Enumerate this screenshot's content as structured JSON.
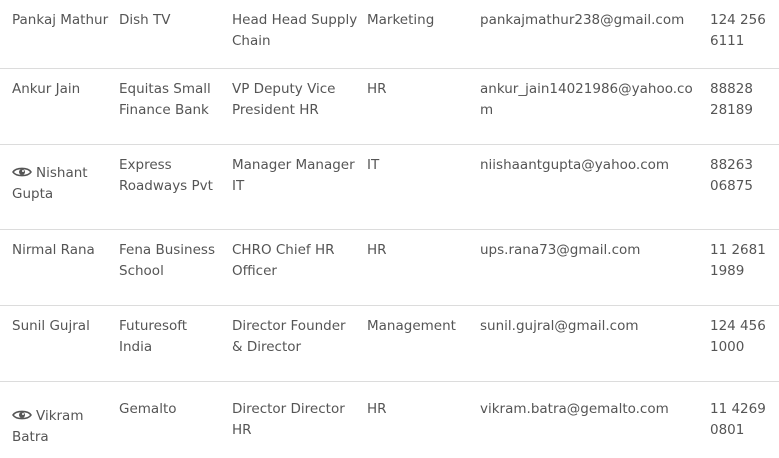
{
  "rows": [
    {
      "name": "Pankaj Mathur",
      "has_view_icon": false,
      "company": "Dish TV",
      "title": "Head Head Supply Chain",
      "department": "Marketing",
      "email": "pankajmathur238@gmail.com",
      "phone": "124 256 6111"
    },
    {
      "name": "Ankur Jain",
      "has_view_icon": false,
      "company": "Equitas Small Finance Bank",
      "title": "VP Deputy Vice President HR",
      "department": "HR",
      "email": "ankur_jain14021986@yahoo.com",
      "phone": "88828 28189"
    },
    {
      "name": "Nishant Gupta",
      "has_view_icon": true,
      "icon": "eye-icon",
      "company": "Express Roadways Pvt",
      "title": "Manager Manager IT",
      "department": "IT",
      "email": "niishaantgupta@yahoo.com",
      "phone": "88263 06875"
    },
    {
      "name": "Nirmal Rana",
      "has_view_icon": false,
      "company": "Fena Business School",
      "title": "CHRO Chief HR Officer",
      "department": "HR",
      "email": "ups.rana73@gmail.com",
      "phone": "11 2681 1989"
    },
    {
      "name": "Sunil Gujral",
      "has_view_icon": false,
      "company": "Futuresoft India",
      "title": "Director Founder & Director",
      "department": "Management",
      "email": "sunil.gujral@gmail.com",
      "phone": "124 456 1000"
    },
    {
      "name": "Vikram Batra",
      "has_view_icon": true,
      "icon": "eye-icon",
      "company": "Gemalto",
      "title": "Director Director HR",
      "department": "HR",
      "email": "vikram.batra@gemalto.com",
      "phone": "11 4269 0801"
    }
  ],
  "colors": {
    "text": "#555555",
    "divider": "#dcdcdc",
    "background": "#ffffff"
  }
}
